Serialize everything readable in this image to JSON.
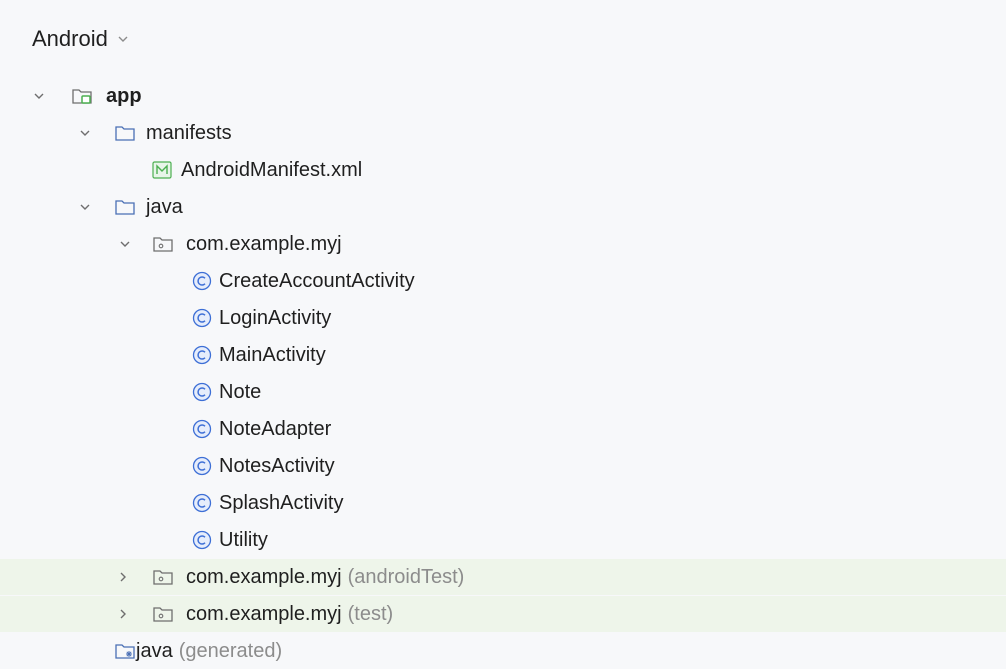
{
  "header": {
    "view_mode": "Android"
  },
  "tree": {
    "app": "app",
    "manifests": "manifests",
    "manifest_file": "AndroidManifest.xml",
    "java": "java",
    "package": "com.example.myj",
    "classes": [
      "CreateAccountActivity",
      "LoginActivity",
      "MainActivity",
      "Note",
      "NoteAdapter",
      "NotesActivity",
      "SplashActivity",
      "Utility"
    ],
    "android_test_package": "com.example.myj",
    "android_test_suffix": "(androidTest)",
    "test_package": "com.example.myj",
    "test_suffix": "(test)",
    "java_generated": "java",
    "java_generated_suffix": "(generated)"
  },
  "colors": {
    "test_row_bg": "#eef5ea",
    "class_icon": "#3d6fd6",
    "manifest_icon": "#4caf50",
    "module_icon_accent": "#4caf50"
  }
}
